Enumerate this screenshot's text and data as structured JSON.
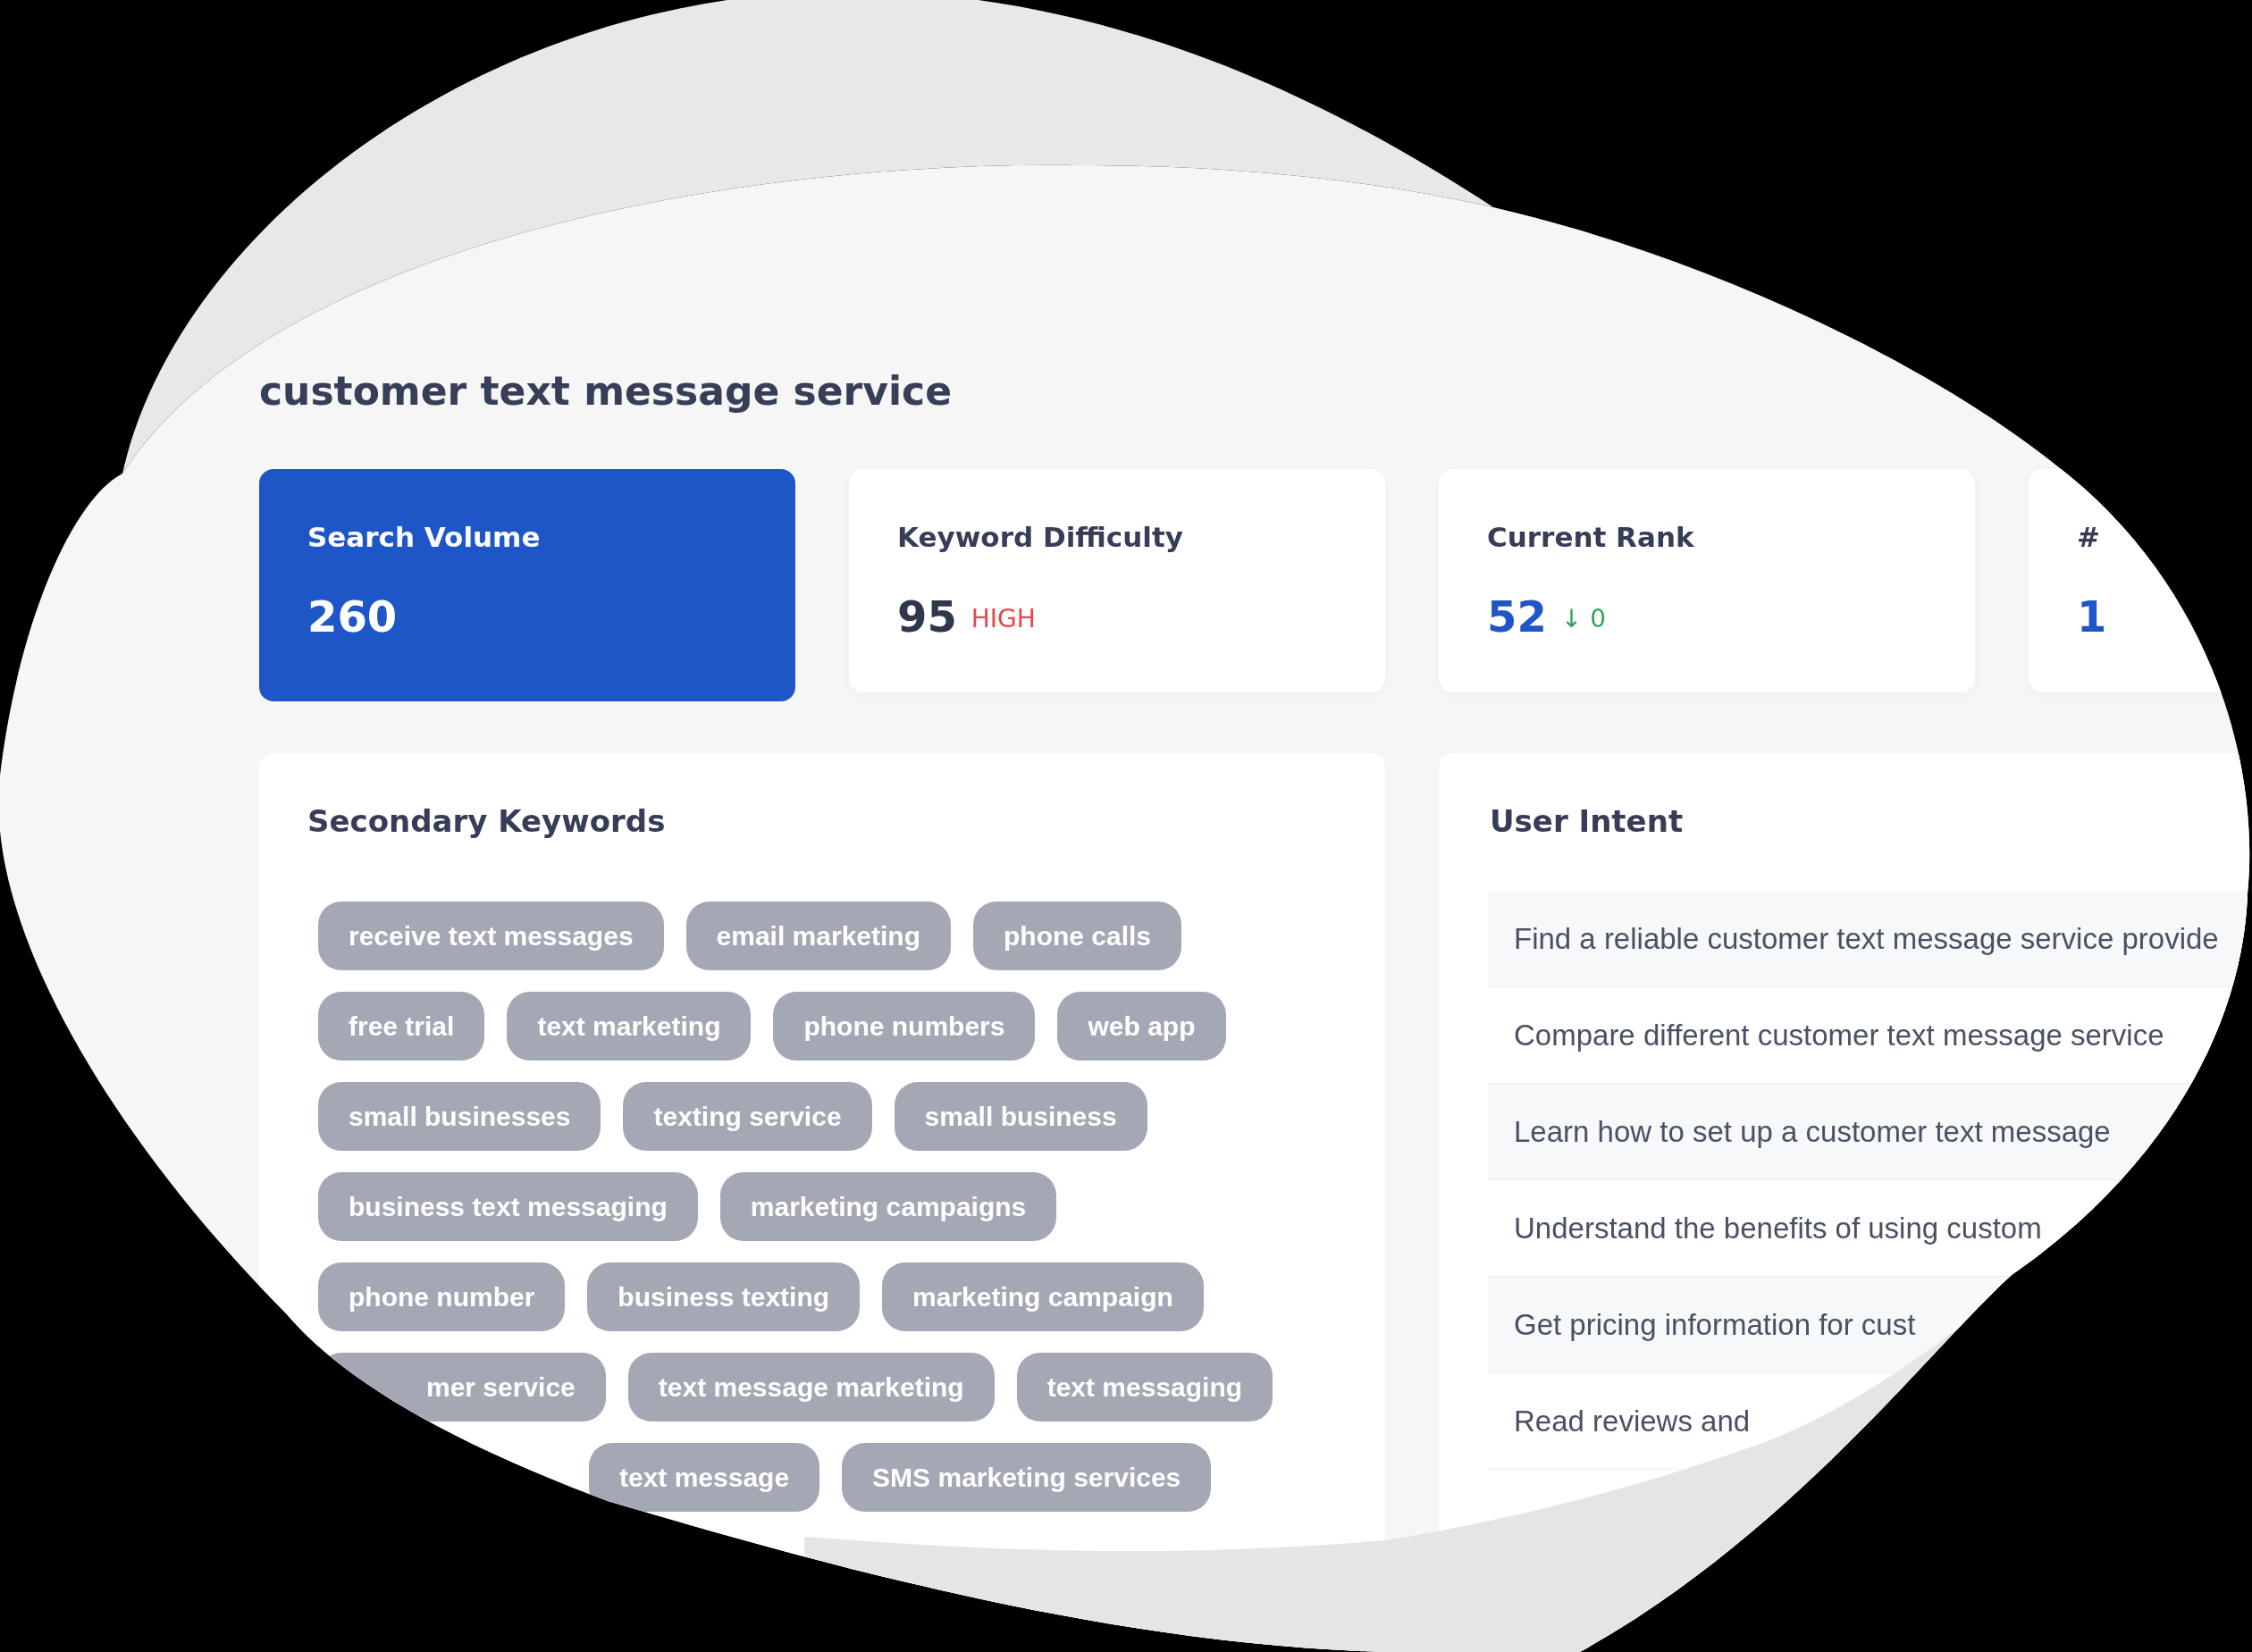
{
  "title": "customer text message service",
  "cards": [
    {
      "label": "Search Volume",
      "value": "260",
      "highlighted": true,
      "accent": false
    },
    {
      "label": "Keyword Difficulty",
      "value": "95",
      "rating": "HIGH",
      "highlighted": false,
      "accent": false
    },
    {
      "label": "Current Rank",
      "value": "52",
      "change": "↓ 0",
      "highlighted": false,
      "accent": true
    },
    {
      "label": "#",
      "value": "1",
      "highlighted": false,
      "accent": true
    }
  ],
  "secondary_keywords": {
    "heading": "Secondary Keywords",
    "rows": [
      [
        "receive text messages",
        "email marketing",
        "phone calls"
      ],
      [
        "free trial",
        "text marketing",
        "phone numbers",
        "web app"
      ],
      [
        "small businesses",
        "texting service",
        "small business"
      ],
      [
        "business text messaging",
        "marketing campaigns"
      ],
      [
        "phone number",
        "business texting",
        "marketing campaign"
      ],
      [
        "mer service",
        "text message marketing",
        "text messaging"
      ],
      [
        "text message",
        "SMS marketing services"
      ]
    ]
  },
  "user_intent": {
    "heading": "User Intent",
    "items": [
      "Find a reliable customer text message service provide",
      "Compare different customer text message service",
      "Learn how to set up a customer text message",
      "Understand the benefits of using custom",
      "Get pricing information for cust",
      "Read reviews and"
    ]
  }
}
